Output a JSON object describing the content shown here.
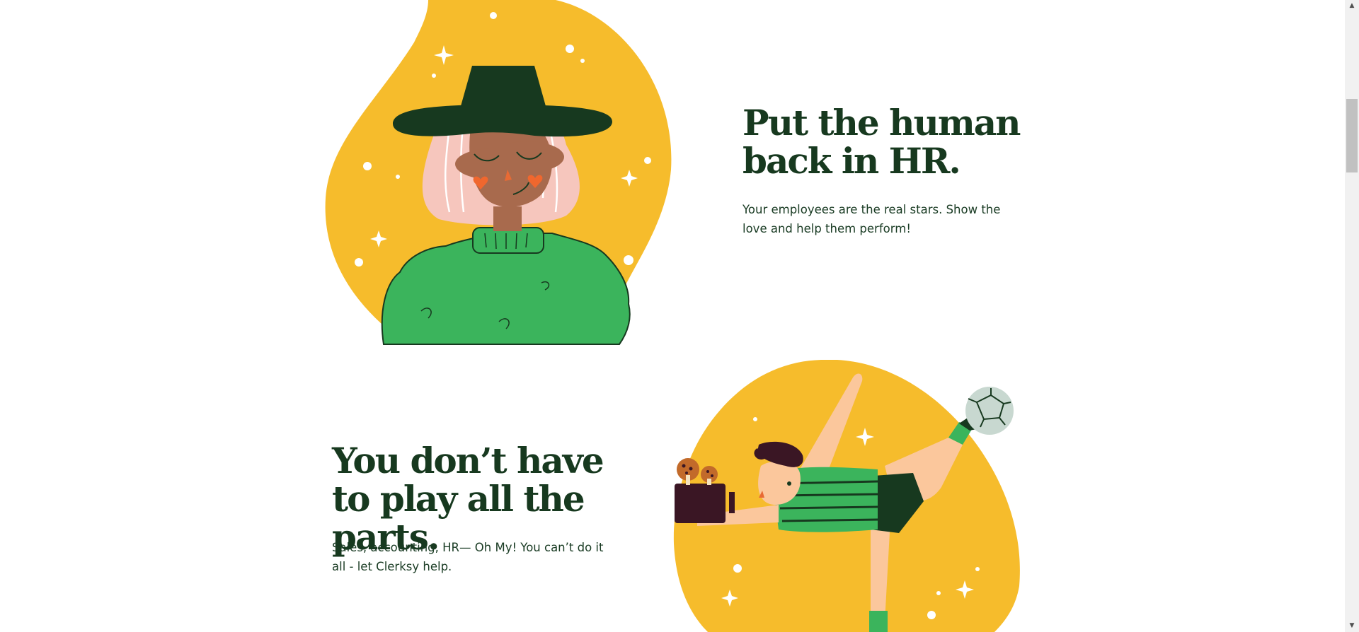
{
  "sections": [
    {
      "heading": "Put the human back in HR.",
      "text": "Your employees are the real stars. Show the love and help them perform!",
      "illustration": "woman-with-hat-illustration"
    },
    {
      "heading": "You don’t have to play all the parts.",
      "text": "Sales, accounting, HR— Oh My! You can’t do it all - let Clerksy help.",
      "illustration": "juggling-man-illustration"
    }
  ],
  "colors": {
    "blob": "#f6bc2c",
    "dark_green": "#17391f",
    "sweater_green": "#3bb45c",
    "skin_dark": "#a86a4d",
    "hair_pink": "#f6c6bd",
    "skin_light": "#fbc79c"
  },
  "scrollbar": {
    "up_icon": "triangle-up",
    "down_icon": "triangle-down"
  }
}
